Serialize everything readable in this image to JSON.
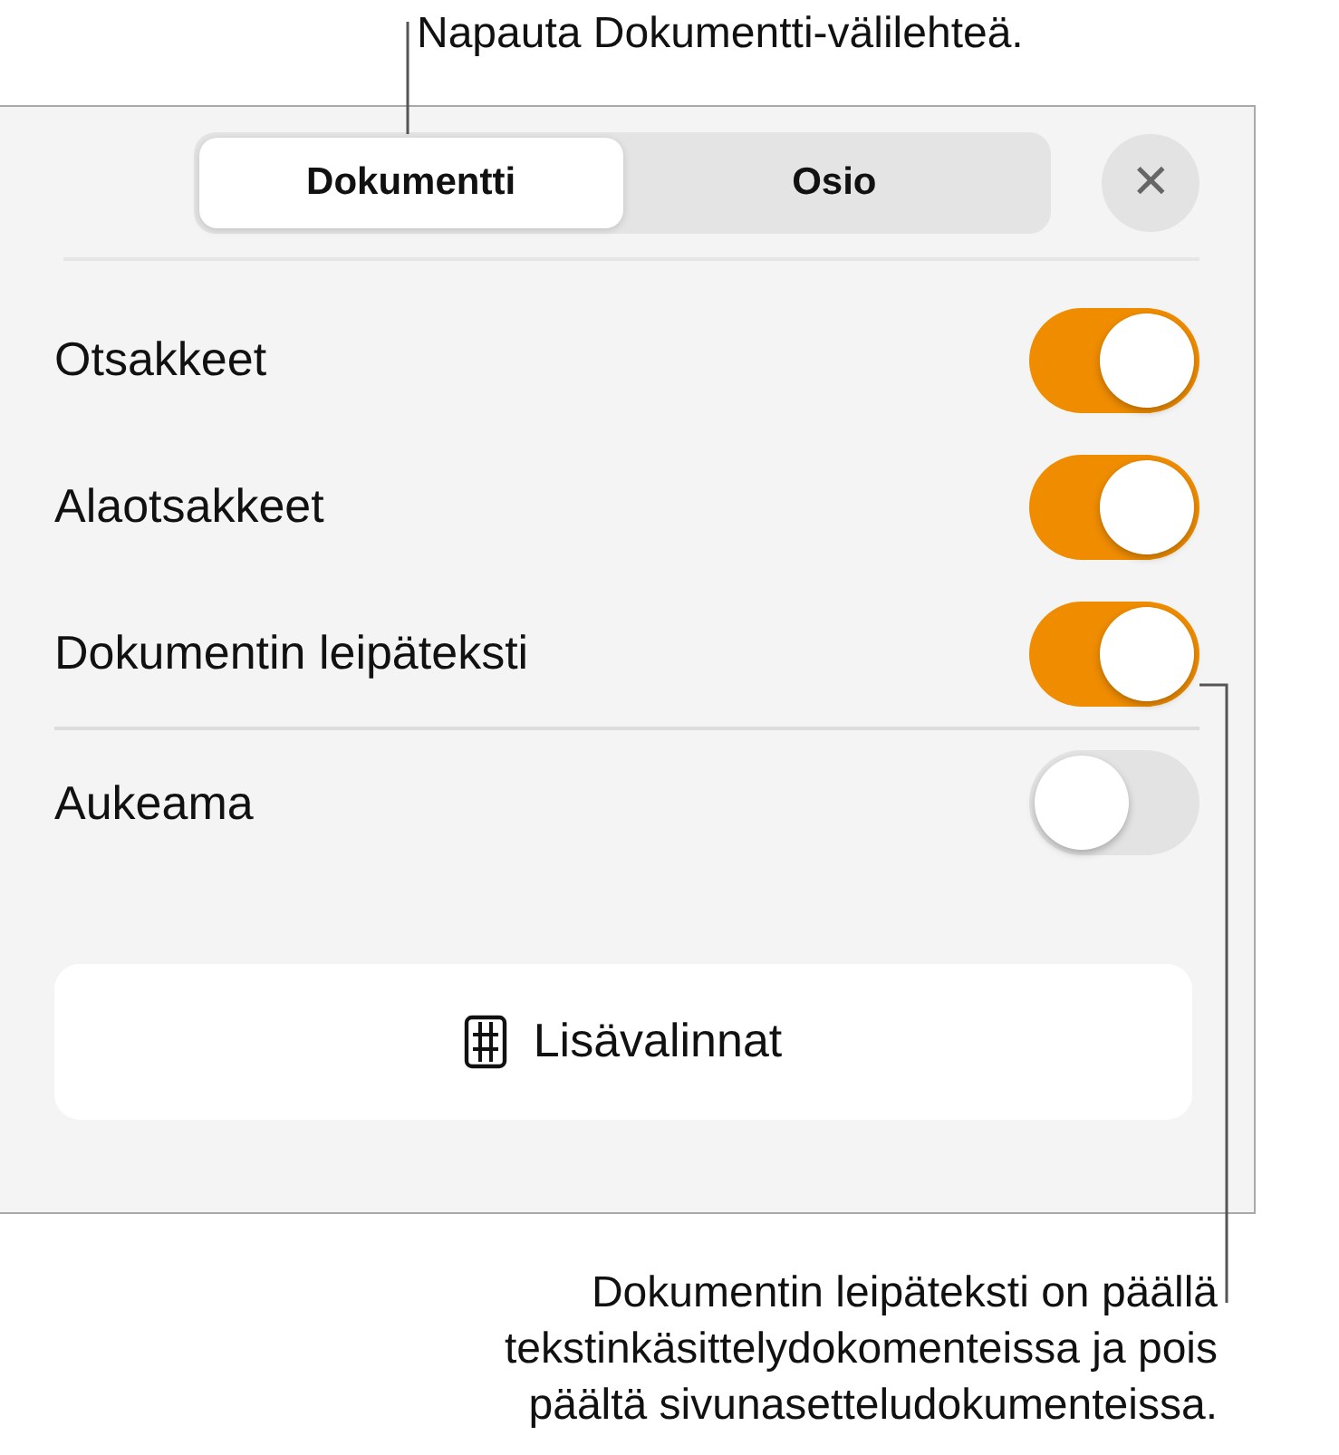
{
  "callout_top": "Napauta Dokumentti-välilehteä.",
  "tabs": [
    {
      "label": "Dokumentti",
      "selected": true
    },
    {
      "label": "Osio",
      "selected": false
    }
  ],
  "close": {
    "label": "✕"
  },
  "toggles_main": [
    {
      "label": "Otsakkeet",
      "on": true
    },
    {
      "label": "Alaotsakkeet",
      "on": true
    },
    {
      "label": "Dokumentin leipäteksti",
      "on": true
    }
  ],
  "toggles_extra": [
    {
      "label": "Aukeama",
      "on": false
    }
  ],
  "more_button": {
    "label": "Lisävalinnat"
  },
  "callout_bottom": "Dokumentin leipäteksti on päällä tekstinkäsittelydokomenteissa ja pois päältä sivunasetteludokumenteissa."
}
